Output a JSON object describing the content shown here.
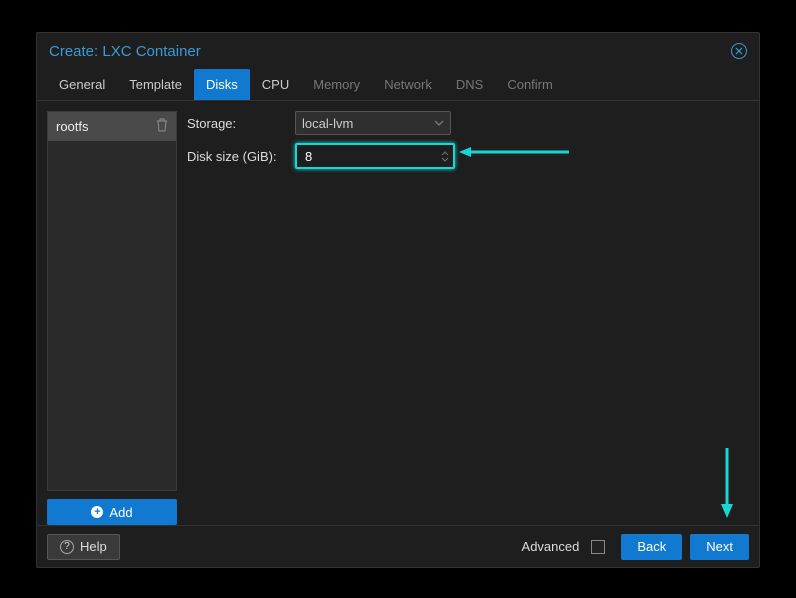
{
  "title": "Create: LXC Container",
  "tabs": [
    {
      "label": "General",
      "state": "normal"
    },
    {
      "label": "Template",
      "state": "normal"
    },
    {
      "label": "Disks",
      "state": "active"
    },
    {
      "label": "CPU",
      "state": "normal"
    },
    {
      "label": "Memory",
      "state": "disabled"
    },
    {
      "label": "Network",
      "state": "disabled"
    },
    {
      "label": "DNS",
      "state": "disabled"
    },
    {
      "label": "Confirm",
      "state": "disabled"
    }
  ],
  "sidebar": {
    "items": [
      {
        "label": "rootfs"
      }
    ],
    "add_label": "Add"
  },
  "form": {
    "storage_label": "Storage:",
    "storage_value": "local-lvm",
    "disksize_label": "Disk size (GiB):",
    "disksize_value": "8"
  },
  "footer": {
    "help_label": "Help",
    "advanced_label": "Advanced",
    "back_label": "Back",
    "next_label": "Next",
    "advanced_checked": false
  },
  "colors": {
    "accent_blue": "#1279d0",
    "title_blue": "#3b9bd6",
    "highlight_cyan": "#16d6d6"
  }
}
